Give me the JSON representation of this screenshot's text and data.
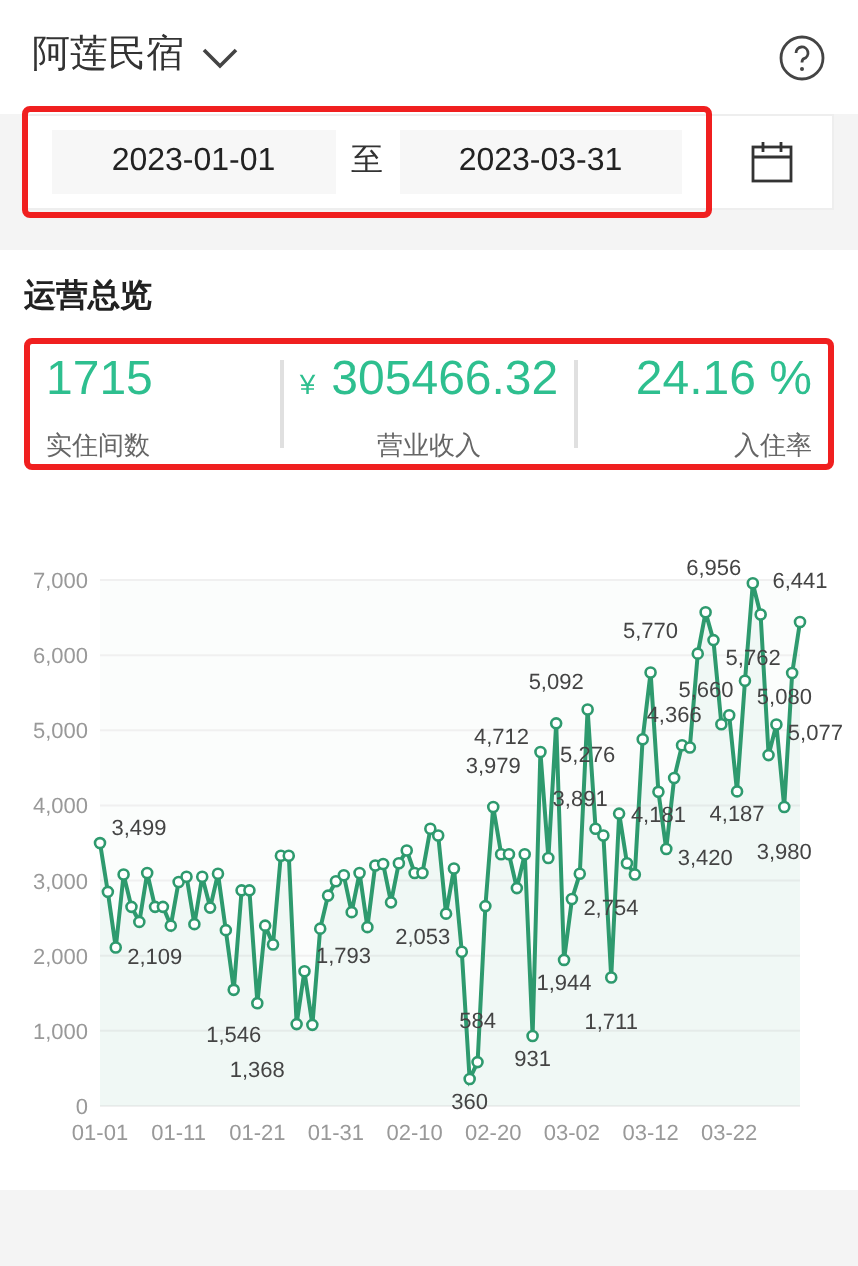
{
  "header": {
    "title": "阿莲民宿"
  },
  "date_range": {
    "start": "2023-01-01",
    "separator": "至",
    "end": "2023-03-31"
  },
  "section_title": "运营总览",
  "stats": [
    {
      "value": "1715",
      "label": "实住间数"
    },
    {
      "currency": "¥",
      "value": "305466.32",
      "label": "营业收入"
    },
    {
      "value": "24.16 %",
      "label": "入住率"
    }
  ],
  "chart": {
    "chart_data": {
      "type": "line",
      "grid": true,
      "categories": [
        "01-01",
        null,
        null,
        null,
        null,
        null,
        null,
        null,
        null,
        null,
        "01-11",
        null,
        null,
        null,
        null,
        null,
        null,
        null,
        null,
        null,
        "01-21",
        null,
        null,
        null,
        null,
        null,
        null,
        null,
        null,
        null,
        "01-31",
        null,
        null,
        null,
        null,
        null,
        null,
        null,
        null,
        null,
        "02-10",
        null,
        null,
        null,
        null,
        null,
        null,
        null,
        null,
        null,
        "02-20",
        null,
        null,
        null,
        null,
        null,
        null,
        null,
        null,
        null,
        "03-02",
        null,
        null,
        null,
        null,
        null,
        null,
        null,
        null,
        null,
        "03-12",
        null,
        null,
        null,
        null,
        null,
        null,
        null,
        null,
        null,
        "03-22",
        null,
        null,
        null,
        null,
        null,
        null,
        null,
        null,
        null
      ],
      "series": [
        {
          "color": "#2e9a6e",
          "marker": "circle",
          "values": [
            3499,
            2850,
            2109,
            3080,
            2650,
            2450,
            3100,
            2650,
            2650,
            2400,
            2980,
            3050,
            2420,
            3050,
            2640,
            3090,
            2340,
            1546,
            2870,
            2870,
            1368,
            2400,
            2150,
            3330,
            3330,
            1090,
            1793,
            1080,
            2360,
            2800,
            2990,
            3070,
            2580,
            3100,
            2380,
            3200,
            3220,
            2710,
            3230,
            3400,
            3100,
            3100,
            3690,
            3600,
            2560,
            3160,
            2053,
            360,
            584,
            2660,
            3979,
            3350,
            3350,
            2900,
            3350,
            931,
            4712,
            3300,
            5092,
            1944,
            2754,
            3090,
            5276,
            3690,
            3600,
            1711,
            3891,
            3230,
            3080,
            4880,
            5770,
            4181,
            3420,
            4366,
            4800,
            4770,
            6020,
            6570,
            6200,
            5080,
            5200,
            4187,
            5660,
            6956,
            6540,
            4670,
            5077,
            3980,
            5762,
            6441
          ]
        }
      ],
      "value_labels": [
        "3,499",
        null,
        "2,109",
        null,
        null,
        null,
        null,
        null,
        null,
        null,
        null,
        null,
        null,
        null,
        null,
        null,
        null,
        "1,546",
        null,
        null,
        "1,368",
        null,
        null,
        null,
        null,
        null,
        "1,793",
        null,
        null,
        null,
        null,
        null,
        null,
        null,
        null,
        null,
        null,
        null,
        null,
        null,
        null,
        null,
        null,
        null,
        null,
        null,
        "2,053",
        "360",
        "584",
        null,
        "3,979",
        null,
        null,
        null,
        null,
        "931",
        "4,712",
        null,
        "5,092",
        "1,944",
        "2,754",
        null,
        "5,276",
        null,
        null,
        "1,711",
        "3,891",
        null,
        null,
        null,
        "5,770",
        "4,181",
        "3,420",
        "4,366",
        null,
        null,
        null,
        null,
        null,
        "5,080",
        null,
        "4,187",
        "5,660",
        "6,956",
        null,
        null,
        "5,077",
        "3,980",
        "5,762",
        "6,441"
      ],
      "ylim": [
        0,
        7000
      ],
      "yticks": [
        {
          "value": 0,
          "label": "0"
        },
        {
          "value": 1000,
          "label": "1,000"
        },
        {
          "value": 2000,
          "label": "2,000"
        },
        {
          "value": 3000,
          "label": "3,000"
        },
        {
          "value": 4000,
          "label": "4,000"
        },
        {
          "value": 5000,
          "label": "5,000"
        },
        {
          "value": 6000,
          "label": "6,000"
        },
        {
          "value": 7000,
          "label": "7,000"
        }
      ]
    }
  }
}
